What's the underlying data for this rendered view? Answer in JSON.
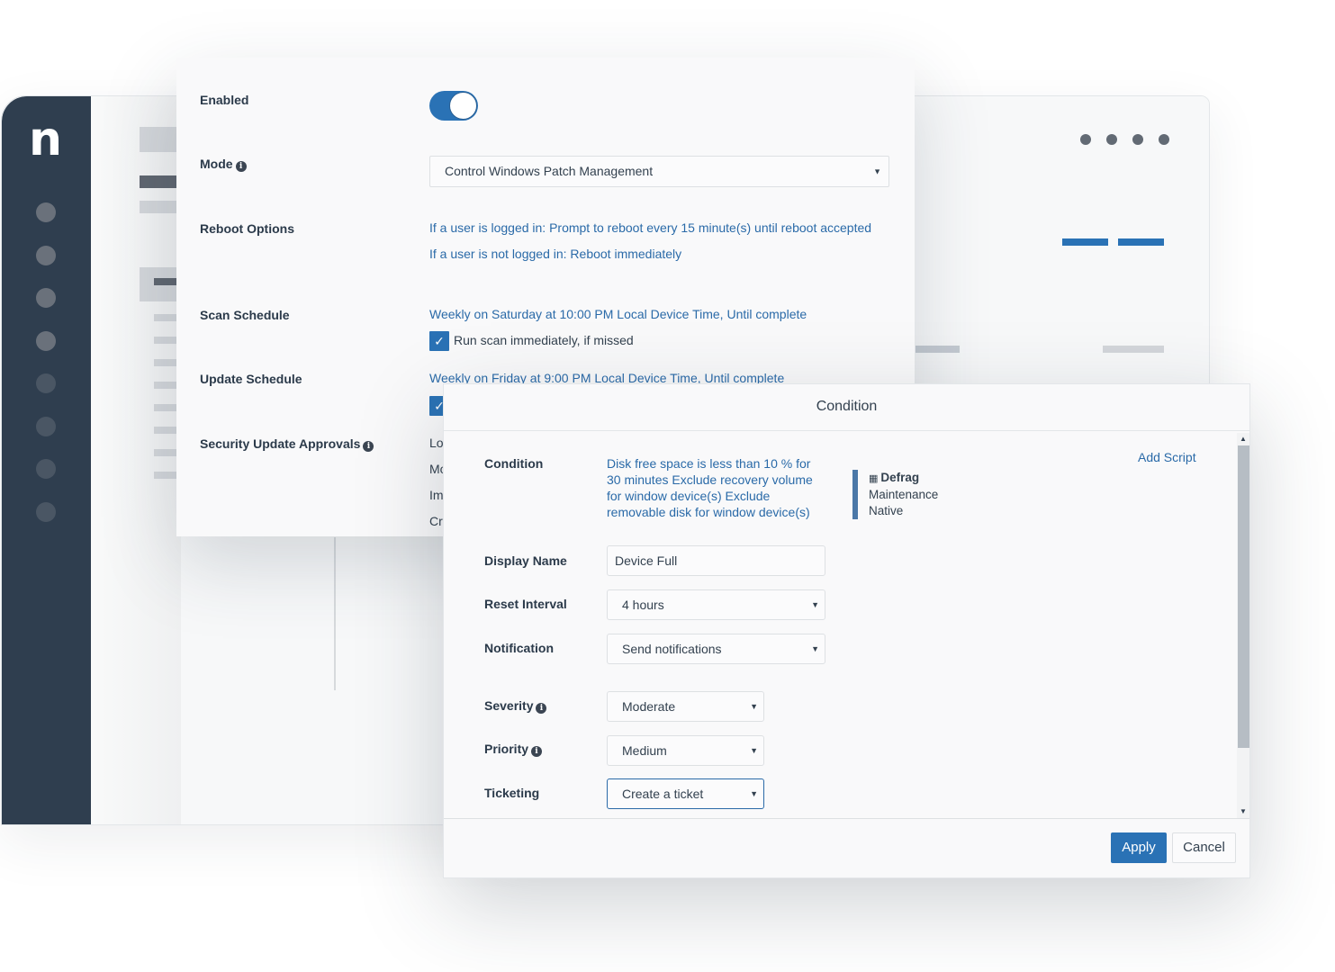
{
  "background_app": {
    "logo": "n",
    "sidebar_dots": 8,
    "more_menu_icon": "more-dots-icon"
  },
  "settings": {
    "enabled": {
      "label": "Enabled",
      "value": true
    },
    "mode": {
      "label": "Mode",
      "value": "Control Windows Patch Management"
    },
    "reboot_options": {
      "label": "Reboot Options",
      "logged_in": "If a user is logged in: Prompt to reboot every 15 minute(s) until reboot accepted",
      "not_logged_in": "If a user is not logged in: Reboot immediately"
    },
    "scan_schedule": {
      "label": "Scan Schedule",
      "value": "Weekly on Saturday at 10:00 PM Local Device Time, Until complete",
      "checkbox_label": "Run scan immediately, if missed",
      "checkbox_checked": true
    },
    "update_schedule": {
      "label": "Update Schedule",
      "value": "Weekly on Friday at 9:00 PM Local Device Time, Until complete",
      "checkbox_checked": true
    },
    "security_update_approvals": {
      "label": "Security Update Approvals",
      "visible_fragments": [
        "Lo",
        "Mo",
        "Im",
        "Cr"
      ]
    }
  },
  "dialog": {
    "title": "Condition",
    "add_script": "Add Script",
    "condition": {
      "label": "Condition",
      "value": "Disk free space is less than 10 % for 30 minutes Exclude recovery volume for window device(s) Exclude removable disk for window device(s)"
    },
    "script": {
      "name": "Defrag",
      "category": "Maintenance",
      "type": "Native"
    },
    "display_name": {
      "label": "Display Name",
      "value": "Device Full"
    },
    "reset_interval": {
      "label": "Reset Interval",
      "value": "4 hours"
    },
    "notification": {
      "label": "Notification",
      "value": "Send notifications"
    },
    "severity": {
      "label": "Severity",
      "value": "Moderate"
    },
    "priority": {
      "label": "Priority",
      "value": "Medium"
    },
    "ticketing": {
      "label": "Ticketing",
      "value": "Create a ticket"
    },
    "apply_label": "Apply",
    "cancel_label": "Cancel"
  },
  "colors": {
    "accent": "#2a72b5",
    "link": "#2a6aa8",
    "sidebar": "#2f3e4f"
  }
}
